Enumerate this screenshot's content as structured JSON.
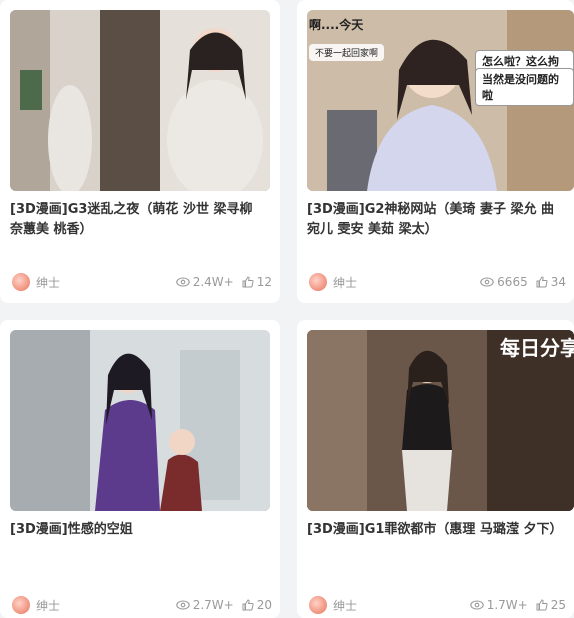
{
  "cards": [
    {
      "title": "[3D漫画]G3迷乱之夜（萌花 沙世 梁寻柳 奈蕙美 桃香）",
      "author": "绅士",
      "views": "2.4W+",
      "likes": "12",
      "thumb_texts": []
    },
    {
      "title": "[3D漫画]G2神秘网站（美琦 妻子 梁允 曲宛儿 雯安 美茹 梁太）",
      "author": "绅士",
      "views": "6665",
      "likes": "34",
      "thumb_texts": [
        "啊....今天",
        "不要一起回家啊",
        "怎么啦？这么拘谨",
        "当然是没问题的啦"
      ]
    },
    {
      "title": "[3D漫画]性感的空姐",
      "author": "绅士",
      "views": "2.7W+",
      "likes": "20",
      "thumb_texts": []
    },
    {
      "title": "[3D漫画]G1罪欲都市（惠理 马璐滢 夕下）",
      "author": "绅士",
      "views": "1.7W+",
      "likes": "25",
      "thumb_texts": [
        "每日分享"
      ]
    }
  ]
}
